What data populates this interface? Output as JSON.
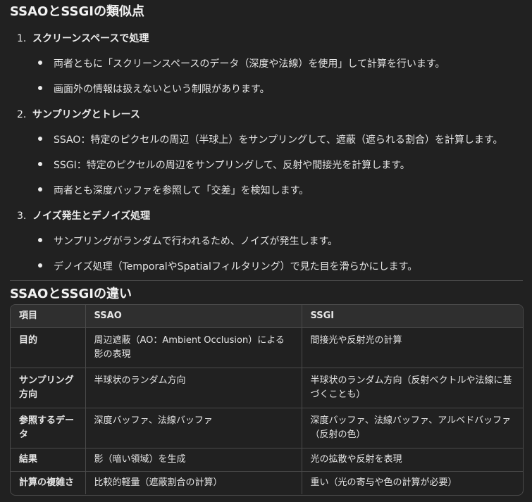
{
  "section_similar": {
    "title": "SSAOとSSGIの類似点",
    "items": [
      {
        "number": "1.",
        "label": "スクリーンスペースで処理",
        "bullets": [
          "両者ともに「スクリーンスペースのデータ（深度や法線）を使用」して計算を行います。",
          "画面外の情報は扱えないという制限があります。"
        ]
      },
      {
        "number": "2.",
        "label": "サンプリングとトレース",
        "bullets": [
          "SSAO：特定のピクセルの周辺（半球上）をサンプリングして、遮蔽（遮られる割合）を計算します。",
          "SSGI：特定のピクセルの周辺をサンプリングして、反射や間接光を計算します。",
          "両者とも深度バッファを参照して「交差」を検知します。"
        ]
      },
      {
        "number": "3.",
        "label": "ノイズ発生とデノイズ処理",
        "bullets": [
          "サンプリングがランダムで行われるため、ノイズが発生します。",
          "デノイズ処理（TemporalやSpatialフィルタリング）で見た目を滑らかにします。"
        ]
      }
    ]
  },
  "section_diff": {
    "title": "SSAOとSSGIの違い",
    "headers": [
      "項目",
      "SSAO",
      "SSGI"
    ],
    "rows": [
      [
        "目的",
        "周辺遮蔽（AO：Ambient Occlusion）による影の表現",
        "間接光や反射光の計算"
      ],
      [
        "サンプリング方向",
        "半球状のランダム方向",
        "半球状のランダム方向（反射ベクトルや法線に基づくことも）"
      ],
      [
        "参照するデータ",
        "深度バッファ、法線バッファ",
        "深度バッファ、法線バッファ、アルベドバッファ（反射の色）"
      ],
      [
        "結果",
        "影（暗い領域）を生成",
        "光の拡散や反射を表現"
      ],
      [
        "計算の複雑さ",
        "比較的軽量（遮蔽割合の計算）",
        "重い（光の寄与や色の計算が必要）"
      ]
    ]
  }
}
